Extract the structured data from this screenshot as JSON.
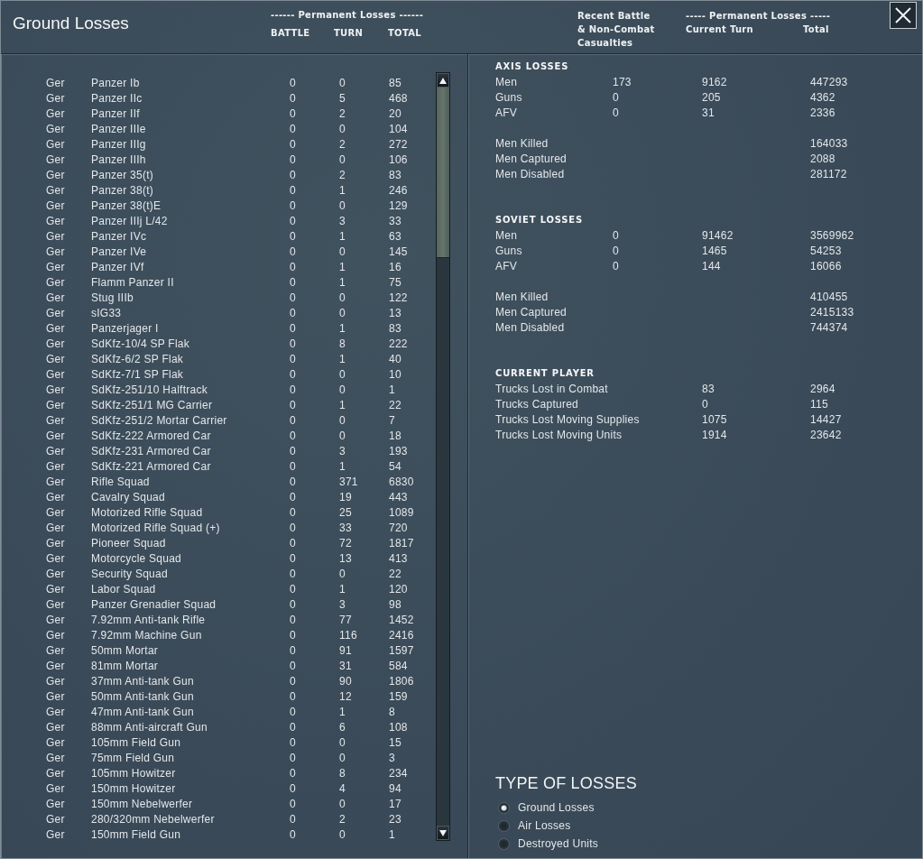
{
  "window": {
    "title": "Ground Losses"
  },
  "left_header": {
    "group": "------ Permanent Losses ------",
    "columns": [
      "BATTLE",
      "TURN",
      "TOTAL"
    ]
  },
  "right_header": {
    "recent_lines": [
      "Recent Battle",
      "& Non-Combat",
      "Casualties"
    ],
    "group": "----- Permanent Losses -----",
    "columns": [
      "Current Turn",
      "Total"
    ]
  },
  "losses_table": {
    "rows": [
      {
        "nation": "Ger",
        "name": "Panzer Ib",
        "battle": "0",
        "turn": "0",
        "total": "85"
      },
      {
        "nation": "Ger",
        "name": "Panzer IIc",
        "battle": "0",
        "turn": "5",
        "total": "468"
      },
      {
        "nation": "Ger",
        "name": "Panzer IIf",
        "battle": "0",
        "turn": "2",
        "total": "20"
      },
      {
        "nation": "Ger",
        "name": "Panzer IIIe",
        "battle": "0",
        "turn": "0",
        "total": "104"
      },
      {
        "nation": "Ger",
        "name": "Panzer IIIg",
        "battle": "0",
        "turn": "2",
        "total": "272"
      },
      {
        "nation": "Ger",
        "name": "Panzer IIIh",
        "battle": "0",
        "turn": "0",
        "total": "106"
      },
      {
        "nation": "Ger",
        "name": "Panzer 35(t)",
        "battle": "0",
        "turn": "2",
        "total": "83"
      },
      {
        "nation": "Ger",
        "name": "Panzer 38(t)",
        "battle": "0",
        "turn": "1",
        "total": "246"
      },
      {
        "nation": "Ger",
        "name": "Panzer 38(t)E",
        "battle": "0",
        "turn": "0",
        "total": "129"
      },
      {
        "nation": "Ger",
        "name": "Panzer IIIj L/42",
        "battle": "0",
        "turn": "3",
        "total": "33"
      },
      {
        "nation": "Ger",
        "name": "Panzer IVc",
        "battle": "0",
        "turn": "1",
        "total": "63"
      },
      {
        "nation": "Ger",
        "name": "Panzer IVe",
        "battle": "0",
        "turn": "0",
        "total": "145"
      },
      {
        "nation": "Ger",
        "name": "Panzer IVf",
        "battle": "0",
        "turn": "1",
        "total": "16"
      },
      {
        "nation": "Ger",
        "name": "Flamm Panzer II",
        "battle": "0",
        "turn": "1",
        "total": "75"
      },
      {
        "nation": "Ger",
        "name": "Stug IIIb",
        "battle": "0",
        "turn": "0",
        "total": "122"
      },
      {
        "nation": "Ger",
        "name": "sIG33",
        "battle": "0",
        "turn": "0",
        "total": "13"
      },
      {
        "nation": "Ger",
        "name": "Panzerjager I",
        "battle": "0",
        "turn": "1",
        "total": "83"
      },
      {
        "nation": "Ger",
        "name": "SdKfz-10/4 SP Flak",
        "battle": "0",
        "turn": "8",
        "total": "222"
      },
      {
        "nation": "Ger",
        "name": "SdKfz-6/2 SP Flak",
        "battle": "0",
        "turn": "1",
        "total": "40"
      },
      {
        "nation": "Ger",
        "name": "SdKfz-7/1 SP Flak",
        "battle": "0",
        "turn": "0",
        "total": "10"
      },
      {
        "nation": "Ger",
        "name": "SdKfz-251/10 Halftrack",
        "battle": "0",
        "turn": "0",
        "total": "1"
      },
      {
        "nation": "Ger",
        "name": "SdKfz-251/1 MG Carrier",
        "battle": "0",
        "turn": "1",
        "total": "22"
      },
      {
        "nation": "Ger",
        "name": "SdKfz-251/2 Mortar Carrier",
        "battle": "0",
        "turn": "0",
        "total": "7"
      },
      {
        "nation": "Ger",
        "name": "SdKfz-222 Armored Car",
        "battle": "0",
        "turn": "0",
        "total": "18"
      },
      {
        "nation": "Ger",
        "name": "SdKfz-231 Armored Car",
        "battle": "0",
        "turn": "3",
        "total": "193"
      },
      {
        "nation": "Ger",
        "name": "SdKfz-221 Armored Car",
        "battle": "0",
        "turn": "1",
        "total": "54"
      },
      {
        "nation": "Ger",
        "name": "Rifle Squad",
        "battle": "0",
        "turn": "371",
        "total": "6830"
      },
      {
        "nation": "Ger",
        "name": "Cavalry Squad",
        "battle": "0",
        "turn": "19",
        "total": "443"
      },
      {
        "nation": "Ger",
        "name": "Motorized Rifle Squad",
        "battle": "0",
        "turn": "25",
        "total": "1089"
      },
      {
        "nation": "Ger",
        "name": "Motorized Rifle Squad (+)",
        "battle": "0",
        "turn": "33",
        "total": "720"
      },
      {
        "nation": "Ger",
        "name": "Pioneer Squad",
        "battle": "0",
        "turn": "72",
        "total": "1817"
      },
      {
        "nation": "Ger",
        "name": "Motorcycle Squad",
        "battle": "0",
        "turn": "13",
        "total": "413"
      },
      {
        "nation": "Ger",
        "name": "Security Squad",
        "battle": "0",
        "turn": "0",
        "total": "22"
      },
      {
        "nation": "Ger",
        "name": "Labor Squad",
        "battle": "0",
        "turn": "1",
        "total": "120"
      },
      {
        "nation": "Ger",
        "name": "Panzer Grenadier Squad",
        "battle": "0",
        "turn": "3",
        "total": "98"
      },
      {
        "nation": "Ger",
        "name": "7.92mm Anti-tank Rifle",
        "battle": "0",
        "turn": "77",
        "total": "1452"
      },
      {
        "nation": "Ger",
        "name": "7.92mm Machine Gun",
        "battle": "0",
        "turn": "116",
        "total": "2416"
      },
      {
        "nation": "Ger",
        "name": "50mm Mortar",
        "battle": "0",
        "turn": "91",
        "total": "1597"
      },
      {
        "nation": "Ger",
        "name": "81mm Mortar",
        "battle": "0",
        "turn": "31",
        "total": "584"
      },
      {
        "nation": "Ger",
        "name": "37mm Anti-tank Gun",
        "battle": "0",
        "turn": "90",
        "total": "1806"
      },
      {
        "nation": "Ger",
        "name": "50mm Anti-tank Gun",
        "battle": "0",
        "turn": "12",
        "total": "159"
      },
      {
        "nation": "Ger",
        "name": "47mm Anti-tank Gun",
        "battle": "0",
        "turn": "1",
        "total": "8"
      },
      {
        "nation": "Ger",
        "name": "88mm Anti-aircraft Gun",
        "battle": "0",
        "turn": "6",
        "total": "108"
      },
      {
        "nation": "Ger",
        "name": "105mm Field Gun",
        "battle": "0",
        "turn": "0",
        "total": "15"
      },
      {
        "nation": "Ger",
        "name": "75mm Field Gun",
        "battle": "0",
        "turn": "0",
        "total": "3"
      },
      {
        "nation": "Ger",
        "name": "105mm Howitzer",
        "battle": "0",
        "turn": "8",
        "total": "234"
      },
      {
        "nation": "Ger",
        "name": "150mm Howitzer",
        "battle": "0",
        "turn": "4",
        "total": "94"
      },
      {
        "nation": "Ger",
        "name": "150mm Nebelwerfer",
        "battle": "0",
        "turn": "0",
        "total": "17"
      },
      {
        "nation": "Ger",
        "name": "280/320mm Nebelwerfer",
        "battle": "0",
        "turn": "2",
        "total": "23"
      },
      {
        "nation": "Ger",
        "name": "150mm Field Gun",
        "battle": "0",
        "turn": "0",
        "total": "1"
      }
    ]
  },
  "summary_sections": [
    {
      "title": "AXIS LOSSES",
      "rows": [
        {
          "label": "Men",
          "recent": "173",
          "current_turn": "9162",
          "total": "447293"
        },
        {
          "label": "Guns",
          "recent": "0",
          "current_turn": "205",
          "total": "4362"
        },
        {
          "label": "AFV",
          "recent": "0",
          "current_turn": "31",
          "total": "2336"
        }
      ],
      "breakdown": [
        {
          "label": "Men Killed",
          "total": "164033"
        },
        {
          "label": "Men Captured",
          "total": "2088"
        },
        {
          "label": "Men Disabled",
          "total": "281172"
        }
      ]
    },
    {
      "title": "SOVIET LOSSES",
      "rows": [
        {
          "label": "Men",
          "recent": "0",
          "current_turn": "91462",
          "total": "3569962"
        },
        {
          "label": "Guns",
          "recent": "0",
          "current_turn": "1465",
          "total": "54253"
        },
        {
          "label": "AFV",
          "recent": "0",
          "current_turn": "144",
          "total": "16066"
        }
      ],
      "breakdown": [
        {
          "label": "Men Killed",
          "total": "410455"
        },
        {
          "label": "Men Captured",
          "total": "2415133"
        },
        {
          "label": "Men Disabled",
          "total": "744374"
        }
      ]
    }
  ],
  "current_player": {
    "title": "CURRENT PLAYER",
    "rows": [
      {
        "label": "Trucks Lost in Combat",
        "current_turn": "83",
        "total": "2964"
      },
      {
        "label": "Trucks Captured",
        "current_turn": "0",
        "total": "115"
      },
      {
        "label": "Trucks Lost Moving Supplies",
        "current_turn": "1075",
        "total": "14427"
      },
      {
        "label": "Trucks Lost Moving Units",
        "current_turn": "1914",
        "total": "23642"
      }
    ]
  },
  "type_of_losses": {
    "title": "TYPE OF LOSSES",
    "options": [
      {
        "label": "Ground Losses",
        "selected": true
      },
      {
        "label": "Air Losses",
        "selected": false
      },
      {
        "label": "Destroyed Units",
        "selected": false
      }
    ]
  }
}
